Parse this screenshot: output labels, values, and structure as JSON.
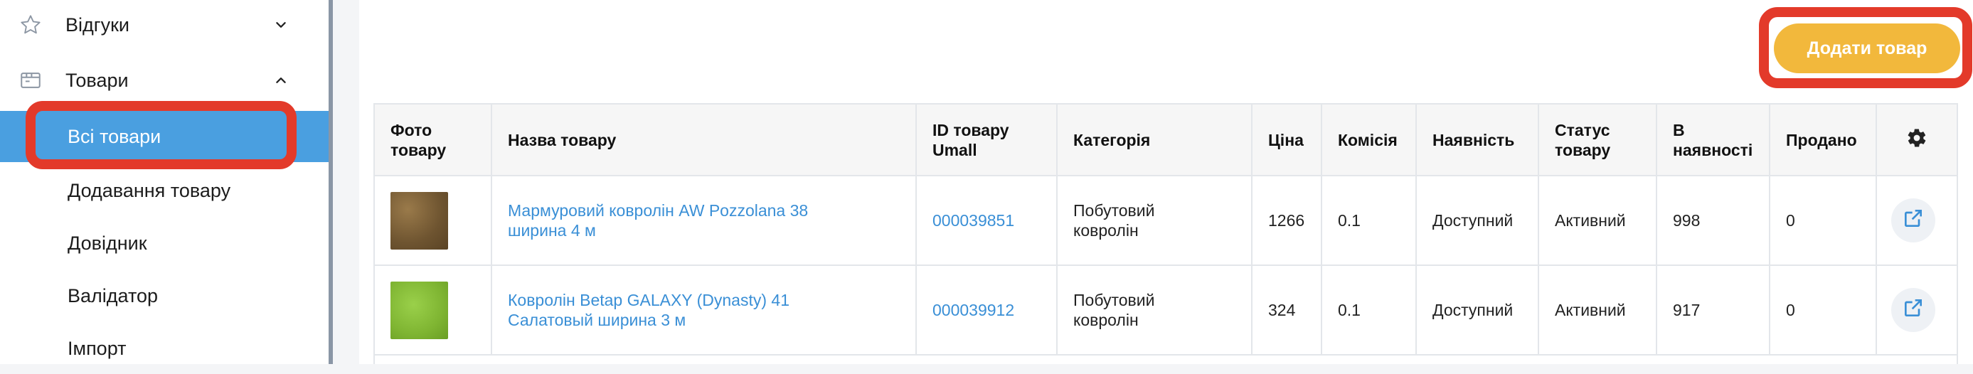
{
  "sidebar": {
    "reviews": {
      "label": "Відгуки",
      "icon": "star-icon"
    },
    "products": {
      "label": "Товари",
      "icon": "box-icon"
    },
    "sub_items": [
      {
        "label": "Всі товари",
        "active": true
      },
      {
        "label": "Додавання товару",
        "active": false
      },
      {
        "label": "Довідник",
        "active": false
      },
      {
        "label": "Валідатор",
        "active": false
      },
      {
        "label": "Імпорт",
        "active": false
      }
    ]
  },
  "toolbar": {
    "add_product_label": "Додати товар"
  },
  "table": {
    "headers": {
      "photo_l1": "Фото",
      "photo_l2": "товару",
      "name": "Назва товару",
      "id_l1": "ID товару",
      "id_l2": "Umall",
      "category": "Категорія",
      "price": "Ціна",
      "commission": "Комісія",
      "availability": "Наявність",
      "status_l1": "Статус",
      "status_l2": "товару",
      "stock_l1": "В",
      "stock_l2": "наявності",
      "sold": "Продано"
    },
    "rows": [
      {
        "name_l1": "Мармуровий ковролін AW Pozzolana 38",
        "name_l2": "ширина 4 м",
        "id": "000039851",
        "category_l1": "Побутовий",
        "category_l2": "ковролін",
        "price": "1266",
        "commission": "0.1",
        "availability": "Доступний",
        "status": "Активний",
        "stock": "998",
        "sold": "0"
      },
      {
        "name_l1": "Ковролін Betap GALAXY (Dynasty) 41",
        "name_l2": "Салатовый ширина 3 м",
        "id": "000039912",
        "category_l1": "Побутовий",
        "category_l2": "ковролін",
        "price": "324",
        "commission": "0.1",
        "availability": "Доступний",
        "status": "Активний",
        "stock": "917",
        "sold": "0"
      }
    ]
  },
  "colors": {
    "accent": "#4a9fe0",
    "add_button": "#f2b83c",
    "highlight": "#e33a2a",
    "link": "#3a8fd6"
  }
}
